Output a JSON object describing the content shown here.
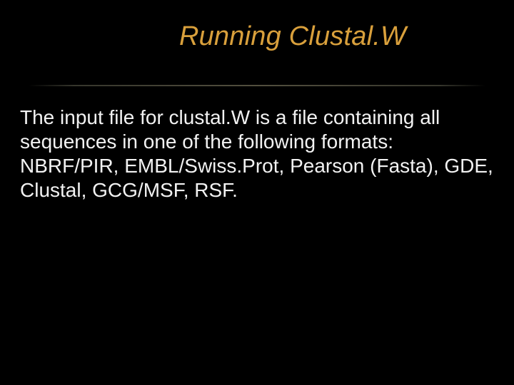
{
  "slide": {
    "title": "Running Clustal.W",
    "body": "The input file for clustal.W is a file containing all sequences in one of the following formats: NBRF/PIR, EMBL/Swiss.Prot, Pearson (Fasta), GDE, Clustal, GCG/MSF, RSF."
  }
}
